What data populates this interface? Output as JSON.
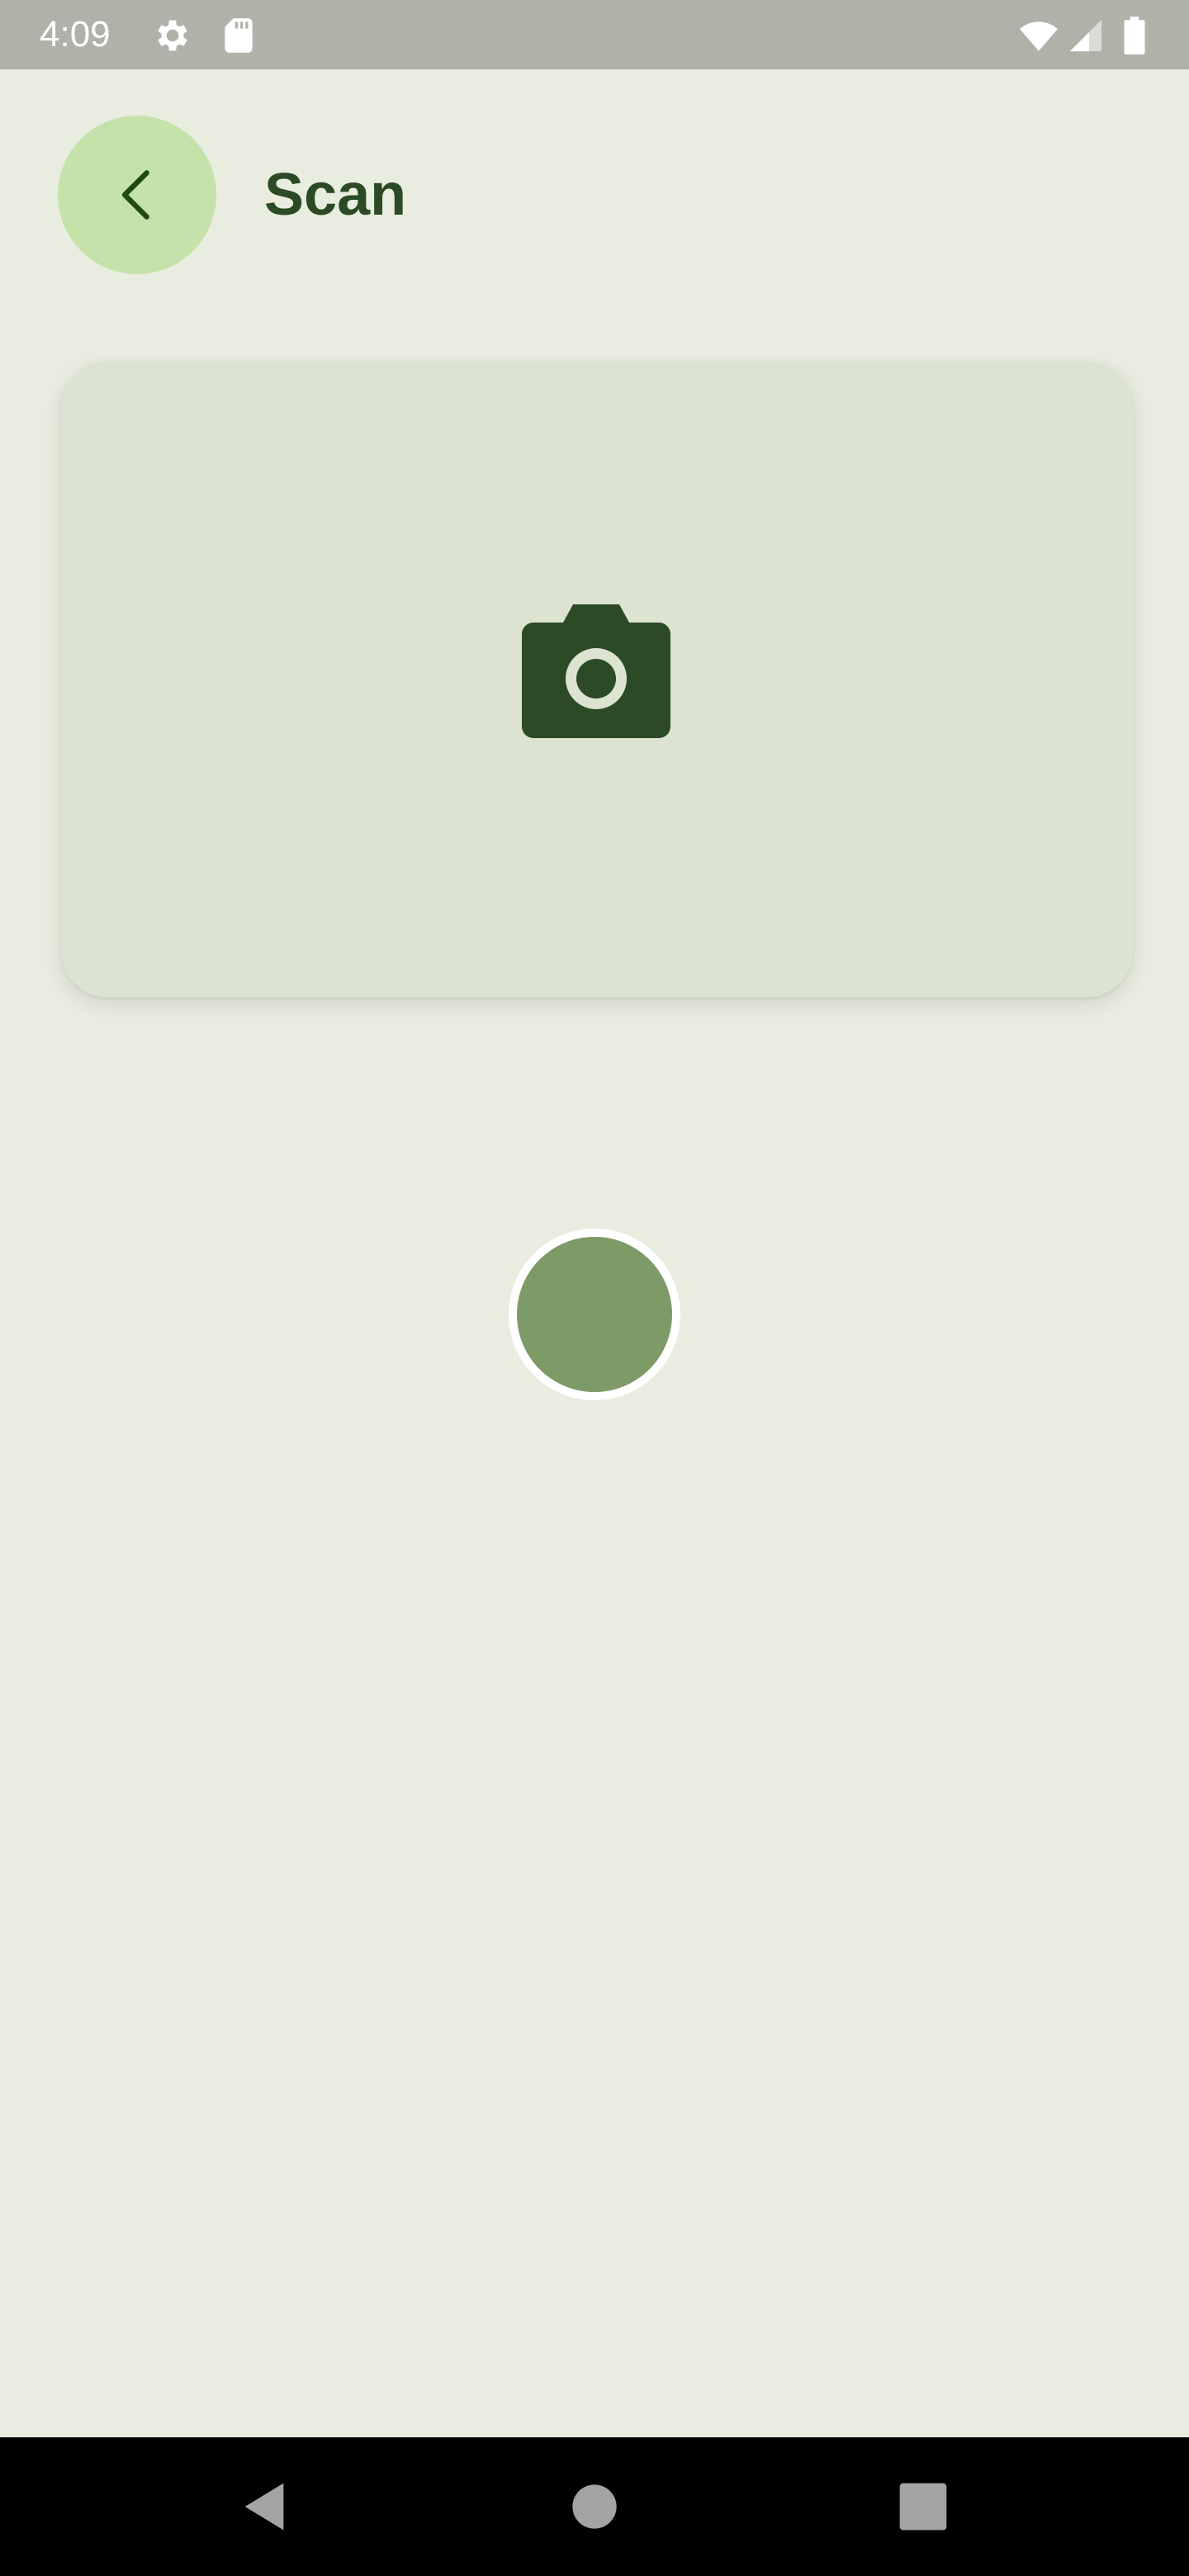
{
  "status_bar": {
    "time": "4:09",
    "icons": [
      "gear-icon",
      "sd-card-icon",
      "wifi-icon",
      "cell-signal-icon",
      "battery-icon"
    ]
  },
  "header": {
    "title": "Scan",
    "back_icon": "chevron-left-icon"
  },
  "camera": {
    "icon": "camera-icon"
  },
  "shutter": {
    "label": ""
  },
  "nav_bar": {
    "buttons": [
      "back-triangle-icon",
      "home-circle-icon",
      "recents-square-icon"
    ]
  },
  "colors": {
    "background": "#e9eddf",
    "status_bar": "#afb2a9",
    "back_button": "#c5e2ab",
    "title": "#2d4a26",
    "preview_card": "#dce3d1",
    "camera_icon": "#2d4a26",
    "shutter": "#7e9a67"
  }
}
